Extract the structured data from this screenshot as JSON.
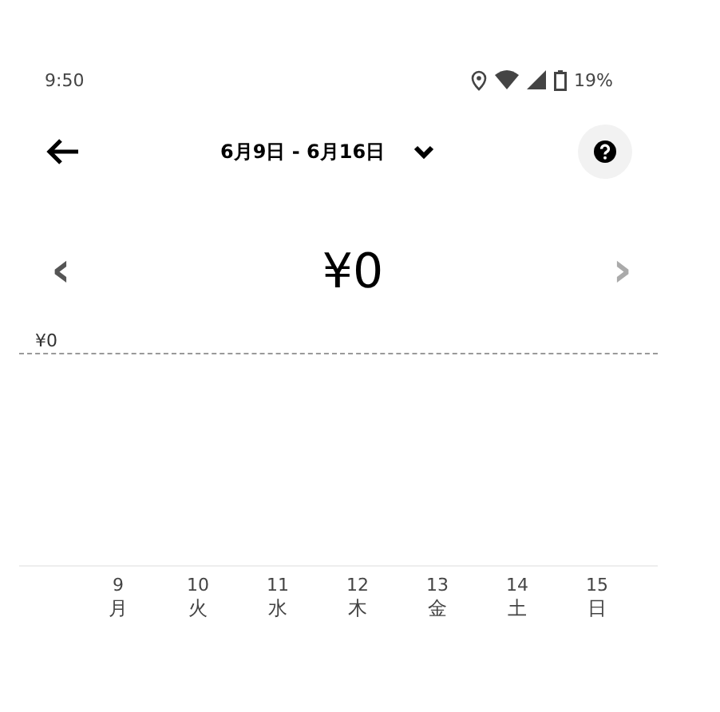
{
  "status_bar": {
    "time": "9:50",
    "battery": "19%"
  },
  "header": {
    "title": "6月9日 - 6月16日"
  },
  "summary": {
    "amount": "¥0",
    "prev": {
      "label": "‹",
      "disabled": false
    },
    "next": {
      "label": "›",
      "disabled": true
    }
  },
  "chart": {
    "y_label": "¥0",
    "days": [
      {
        "date": "9",
        "weekday": "月"
      },
      {
        "date": "10",
        "weekday": "火"
      },
      {
        "date": "11",
        "weekday": "水"
      },
      {
        "date": "12",
        "weekday": "木"
      },
      {
        "date": "13",
        "weekday": "金"
      },
      {
        "date": "14",
        "weekday": "土"
      },
      {
        "date": "15",
        "weekday": "日"
      }
    ]
  }
}
